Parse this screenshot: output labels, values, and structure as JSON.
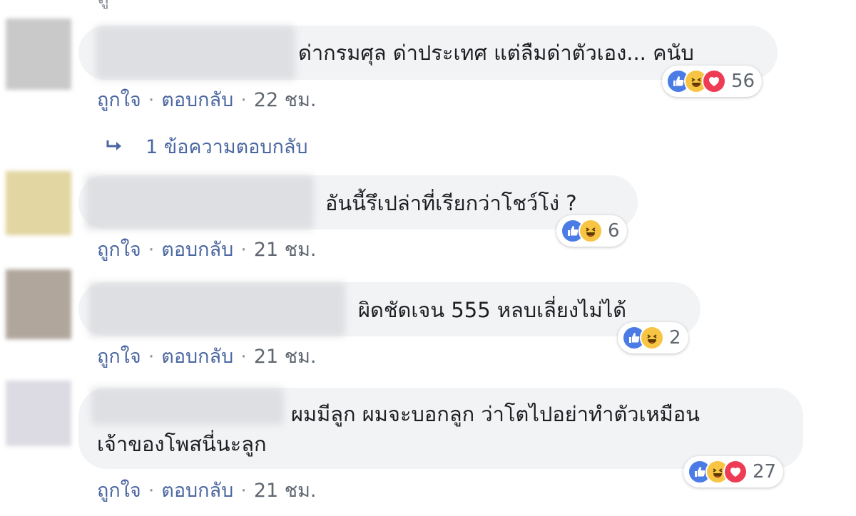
{
  "top_fragment": "ถู",
  "actions": {
    "like": "ถูกใจ",
    "reply": "ตอบกลับ",
    "separator": "·"
  },
  "comments": [
    {
      "text": "ด่ากรมศุล ด่าประเทศ แต่ลืมด่าตัวเอง... คนับ",
      "time": "22 ชม.",
      "reactions": [
        "like",
        "haha",
        "love"
      ],
      "reaction_count": "56",
      "avatar_color": "#c9c9c9"
    },
    {
      "text": "อันนี้รึเปล่าที่เรียกว่าโชว์โง่ ?",
      "time": "21 ชม.",
      "reactions": [
        "like",
        "haha"
      ],
      "reaction_count": "6",
      "avatar_color": "#e2d6a2"
    },
    {
      "text": "ผิดชัดเจน 555 หลบเลี่ยงไม่ได้",
      "time": "21 ชม.",
      "reactions": [
        "like",
        "haha"
      ],
      "reaction_count": "2",
      "avatar_color": "#b0a69c"
    },
    {
      "text_line1": "ผมมีลูก ผมจะบอกลูก ว่าโตไปอย่าทำตัวเหมือน",
      "text_line2": "เจ้าของโพสนี่นะลูก",
      "time": "21 ชม.",
      "reactions": [
        "like",
        "haha",
        "love"
      ],
      "reaction_count": "27",
      "avatar_color": "#dcdbe3"
    }
  ],
  "replies_link": "1 ข้อความตอบกลับ",
  "colors": {
    "bubble": "#f2f3f5",
    "link": "#4b67a1",
    "like": "#4b7ce6",
    "haha": "#f7c543",
    "love": "#ef3c55"
  }
}
